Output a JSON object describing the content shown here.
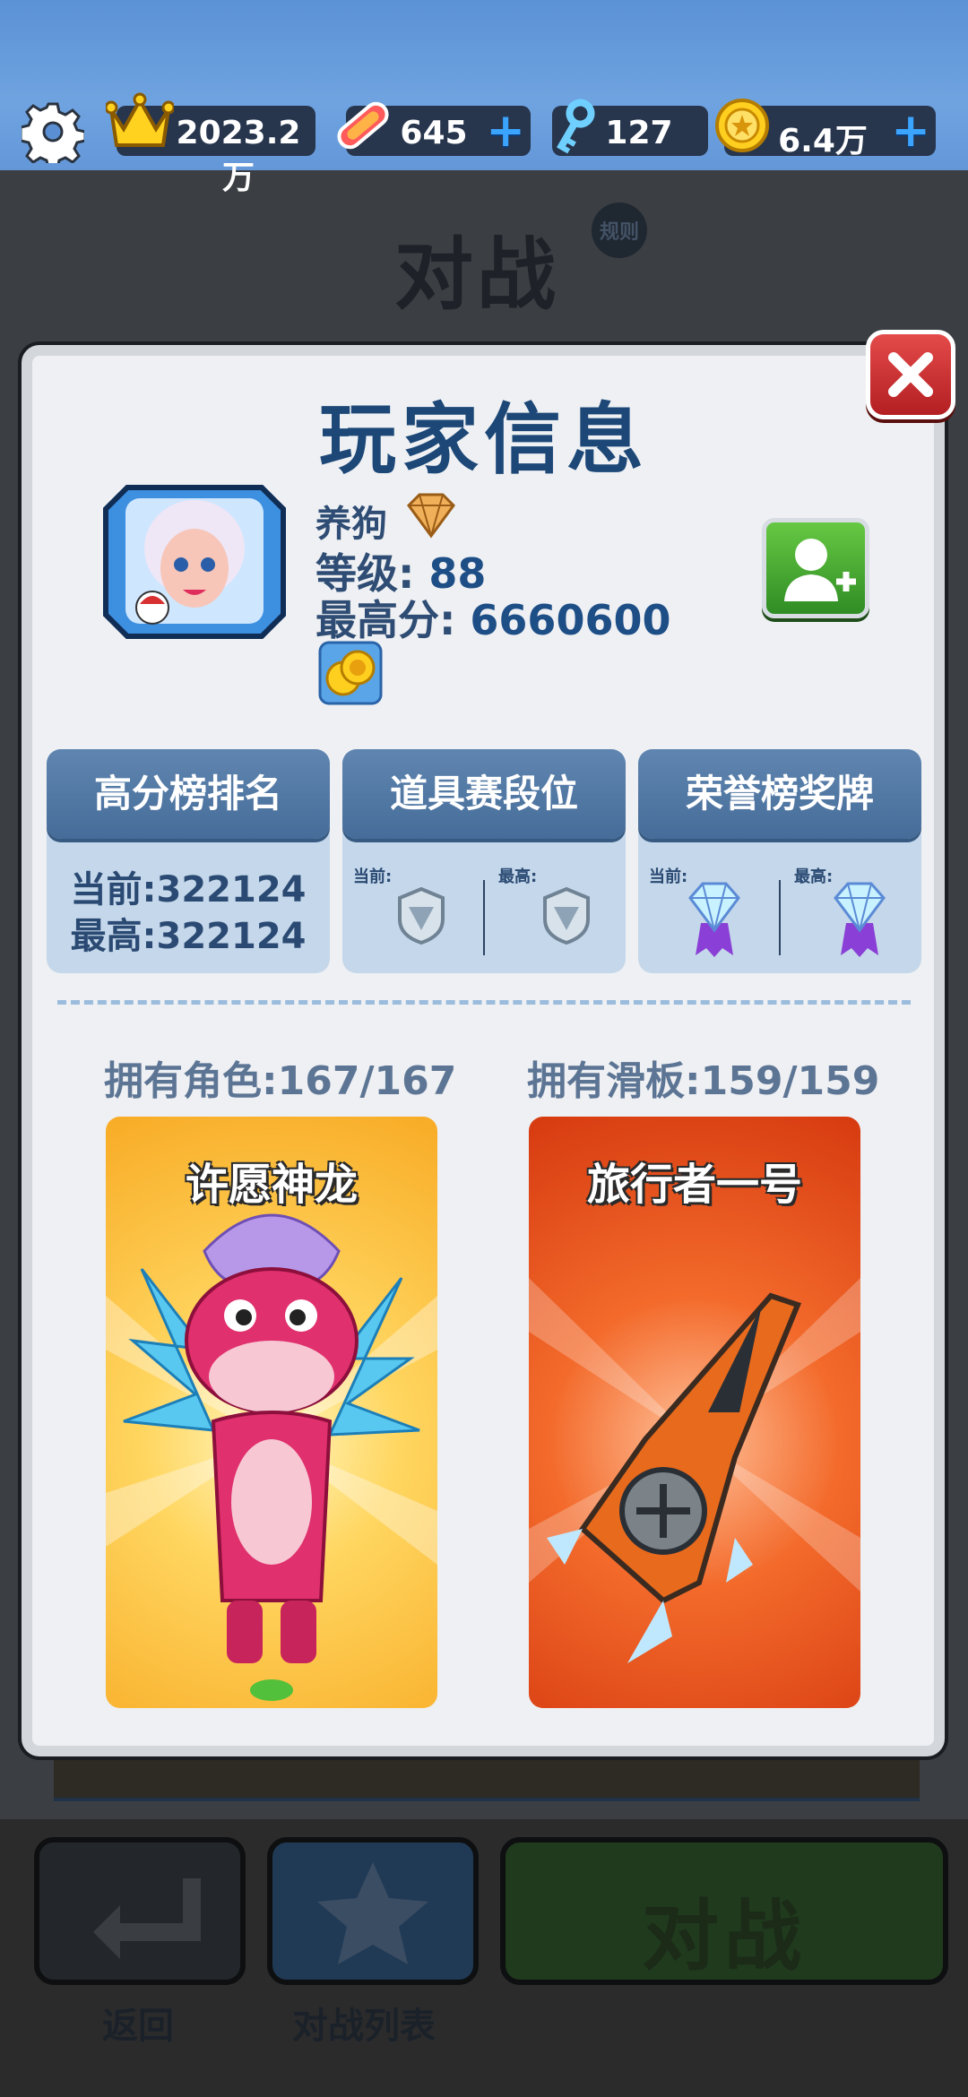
{
  "topbar": {
    "crowns": "2023.2万",
    "boards": "645",
    "keys": "127",
    "coins": "6.4万"
  },
  "background": {
    "title": "对战",
    "rules": "规则",
    "back_label": "返回",
    "list_label": "对战列表",
    "battle_label": "对战"
  },
  "modal": {
    "title": "玩家信息",
    "player": {
      "name": "养狗",
      "level_label": "等级:",
      "level": "88",
      "best_label": "最高分:",
      "best_score": "6660600"
    },
    "stats": [
      {
        "title": "高分榜排名",
        "current_label": "当前:322124",
        "best_label": "最高:322124"
      },
      {
        "title": "道具赛段位",
        "current": "当前:",
        "best": "最高:"
      },
      {
        "title": "荣誉榜奖牌",
        "current": "当前:",
        "best": "最高:"
      }
    ],
    "characters_owned": "拥有角色:167/167",
    "boards_owned": "拥有滑板:159/159",
    "character_name": "许愿神龙",
    "board_name": "旅行者一号"
  },
  "colors": {
    "title_blue": "#1c4777",
    "card_header": "#466c99",
    "card_body": "#c5d7ea",
    "close_red": "#c9282b",
    "friend_green": "#3fa12f"
  },
  "icons": [
    "gear-icon",
    "crown-icon",
    "hoverboard-icon",
    "key-icon",
    "coin-icon",
    "close-icon",
    "add-friend-icon",
    "silver-trophy-icon",
    "diamond-medal-icon"
  ]
}
